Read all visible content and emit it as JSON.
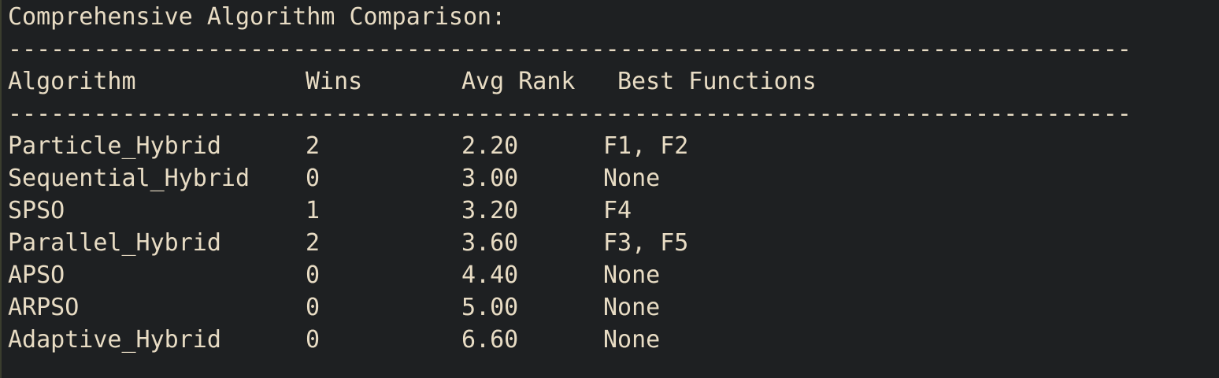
{
  "title": "Comprehensive Algorithm Comparison:",
  "separator": "-------------------------------------------------------------------------------",
  "columns": {
    "algorithm": "Algorithm",
    "wins": "Wins",
    "avg_rank": "Avg Rank",
    "best_functions": "Best Functions"
  },
  "rows": [
    {
      "algorithm": "Particle_Hybrid",
      "wins": "2",
      "avg_rank": "2.20",
      "best": "F1, F2"
    },
    {
      "algorithm": "Sequential_Hybrid",
      "wins": "0",
      "avg_rank": "3.00",
      "best": "None"
    },
    {
      "algorithm": "SPSO",
      "wins": "1",
      "avg_rank": "3.20",
      "best": "F4"
    },
    {
      "algorithm": "Parallel_Hybrid",
      "wins": "2",
      "avg_rank": "3.60",
      "best": "F3, F5"
    },
    {
      "algorithm": "APSO",
      "wins": "0",
      "avg_rank": "4.40",
      "best": "None"
    },
    {
      "algorithm": "ARPSO",
      "wins": "0",
      "avg_rank": "5.00",
      "best": "None"
    },
    {
      "algorithm": "Adaptive_Hybrid",
      "wins": "0",
      "avg_rank": "6.60",
      "best": "None"
    }
  ]
}
